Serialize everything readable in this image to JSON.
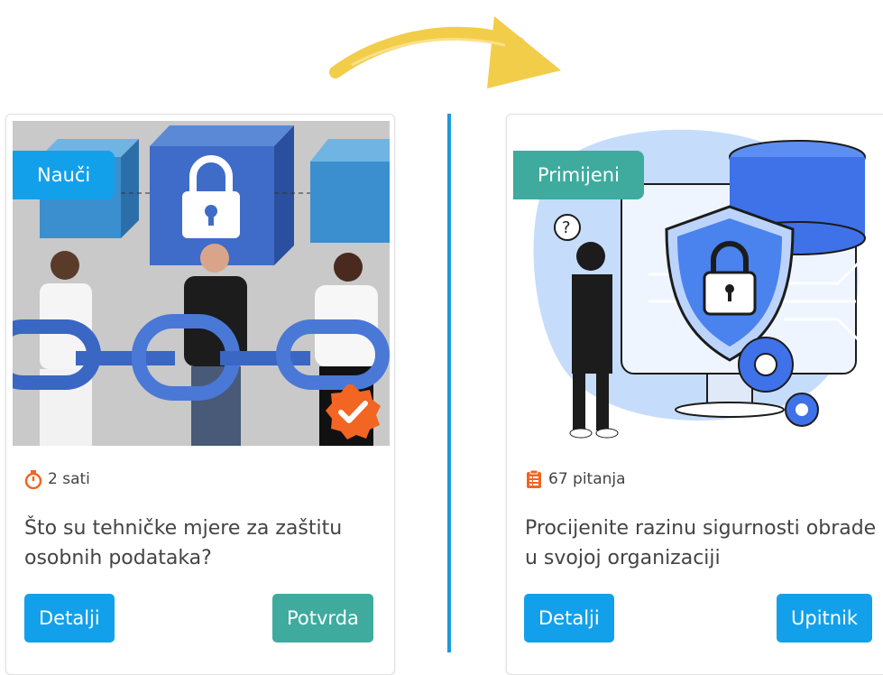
{
  "left_card": {
    "tag": "Nauči",
    "meta_icon": "stopwatch-icon",
    "meta_text": "2 sati",
    "title": "Što su tehničke mjere za zaštitu osobnih podataka?",
    "details_button": "Detalji",
    "action_button": "Potvrda",
    "completed_badge_icon": "checkmark-seal-icon"
  },
  "right_card": {
    "tag": "Primijeni",
    "meta_icon": "clipboard-list-icon",
    "meta_text": "67 pitanja",
    "title": "Procijenite razinu sigurnosti obrade u svojoj organizaciji",
    "details_button": "Detalji",
    "action_button": "Upitnik"
  },
  "colors": {
    "blue": "#13a0ea",
    "teal": "#3eab9e",
    "divider": "#1e9ad6",
    "arrow": "#f2cd4a",
    "badge": "#f26522"
  }
}
